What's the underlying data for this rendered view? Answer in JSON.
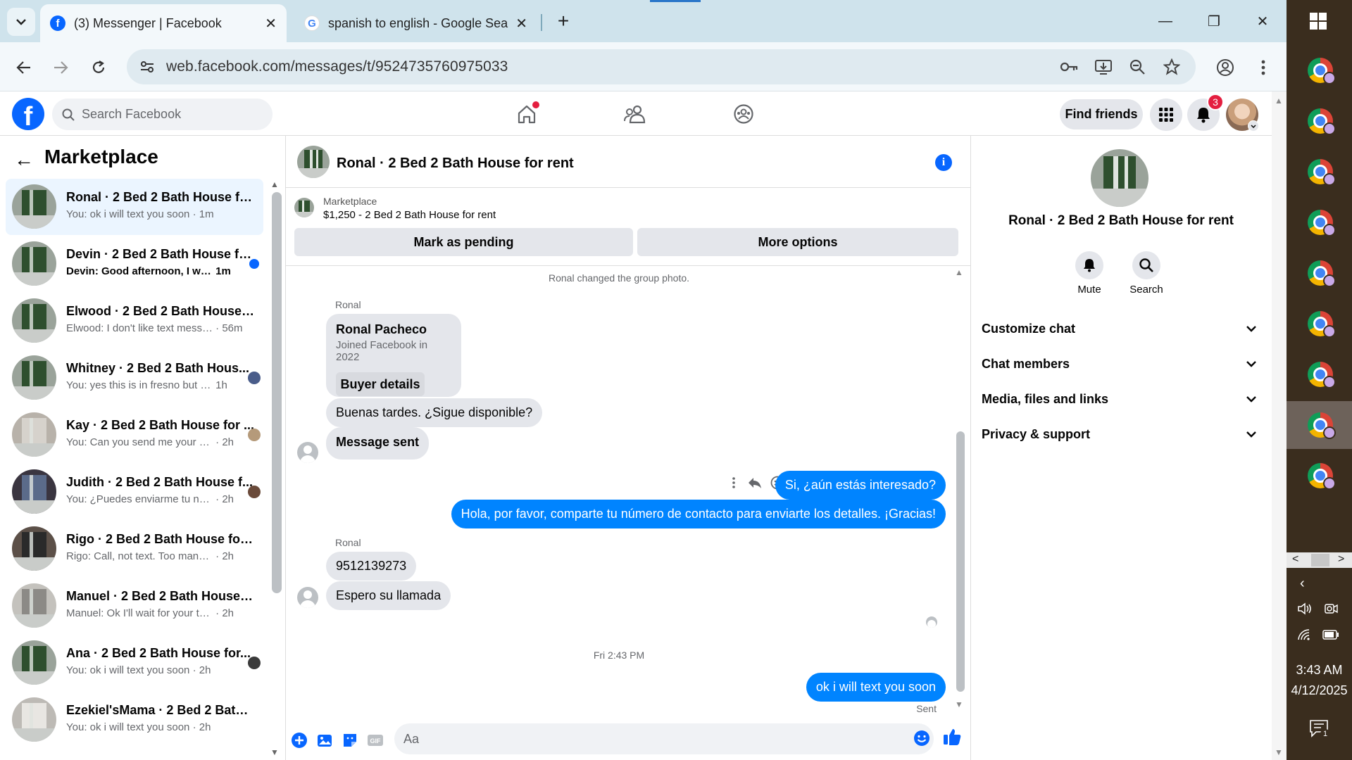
{
  "browser": {
    "tab_active_title": "(3) Messenger | Facebook",
    "tab_inactive_title": "spanish to english - Google Sea",
    "url": "web.facebook.com/messages/t/9524735760975033",
    "tab_list_icon": "chevron-down-icon",
    "new_tab_symbol": "+",
    "close_symbol": "✕",
    "minimize_symbol": "—",
    "restore_symbol": "❐",
    "window_close_symbol": "✕"
  },
  "facebook": {
    "logo_letter": "f",
    "search_placeholder": "Search Facebook",
    "find_friends": "Find friends",
    "notification_count": "3",
    "brand_color": "#0866ff"
  },
  "left_panel": {
    "back_symbol": "←",
    "title": "Marketplace",
    "conversations": [
      {
        "title": "Ronal · 2 Bed 2 Bath House for ...",
        "preview": "You: ok i will text you soon",
        "time": "· 1m",
        "active": true
      },
      {
        "title": "Devin · 2 Bed 2 Bath House fo...",
        "preview": "Devin: Good afternoon, I was j...",
        "time": "1m",
        "unread": true
      },
      {
        "title": "Elwood · 2 Bed 2 Bath House fo...",
        "preview": "Elwood: I don't like text messages",
        "time": "· 56m"
      },
      {
        "title": "Whitney · 2 Bed 2 Bath Hous...",
        "preview": "You: yes this is in fresno but ple...",
        "time": "1h"
      },
      {
        "title": "Kay · 2 Bed 2 Bath House for ...",
        "preview": "You: Can you send me your mo...",
        "time": "· 2h"
      },
      {
        "title": "Judith · 2 Bed 2 Bath House f...",
        "preview": "You: ¿Puedes enviarme tu núm...",
        "time": "· 2h"
      },
      {
        "title": "Rigo · 2 Bed 2 Bath House for r...",
        "preview": "Rigo: Call, not text. Too many sca...",
        "time": "· 2h"
      },
      {
        "title": "Manuel · 2 Bed 2 Bath House fo...",
        "preview": "Manuel: Ok I'll wait for your text",
        "time": "· 2h"
      },
      {
        "title": "Ana · 2 Bed 2 Bath House for...",
        "preview": "You: ok i will text you soon",
        "time": "· 2h"
      },
      {
        "title": "Ezekiel'sMama · 2 Bed 2 Bath H...",
        "preview": "You: ok i will text you soon",
        "time": "· 2h"
      }
    ]
  },
  "chat": {
    "title": "Ronal · 2 Bed 2 Bath House for rent",
    "info_symbol": "i",
    "marketplace_label": "Marketplace",
    "listing": "$1,250 - 2 Bed 2 Bath House for rent",
    "mark_pending": "Mark as pending",
    "more_options": "More options",
    "system_message": "Ronal changed the group photo.",
    "sender_name": "Ronal",
    "card_name": "Ronal Pacheco",
    "card_sub": "Joined Facebook in 2022",
    "buyer_details": "Buyer details",
    "msg_in_1": "Buenas tardes. ¿Sigue disponible?",
    "msg_in_2": "Message sent",
    "msg_out_1": "Si, ¿aún estás interesado?",
    "msg_out_2": "Hola, por favor, comparte tu número de contacto para enviarte los detalles. ¡Gracias!",
    "sender_name_2": "Ronal",
    "msg_in_3": "9512139273",
    "msg_in_4": "Espero su llamada",
    "timestamp": "Fri 2:43 PM",
    "msg_out_3": "ok i will text you soon",
    "status": "Sent",
    "composer_placeholder": "Aa",
    "outgoing_color": "#0084ff"
  },
  "right_panel": {
    "title": "Ronal · 2 Bed 2 Bath House for rent",
    "mute_label": "Mute",
    "search_label": "Search",
    "sections": [
      "Customize chat",
      "Chat members",
      "Media, files and links",
      "Privacy & support"
    ]
  },
  "taskbar": {
    "time": "3:43 AM",
    "date": "4/12/2025",
    "notification_count": "1"
  }
}
